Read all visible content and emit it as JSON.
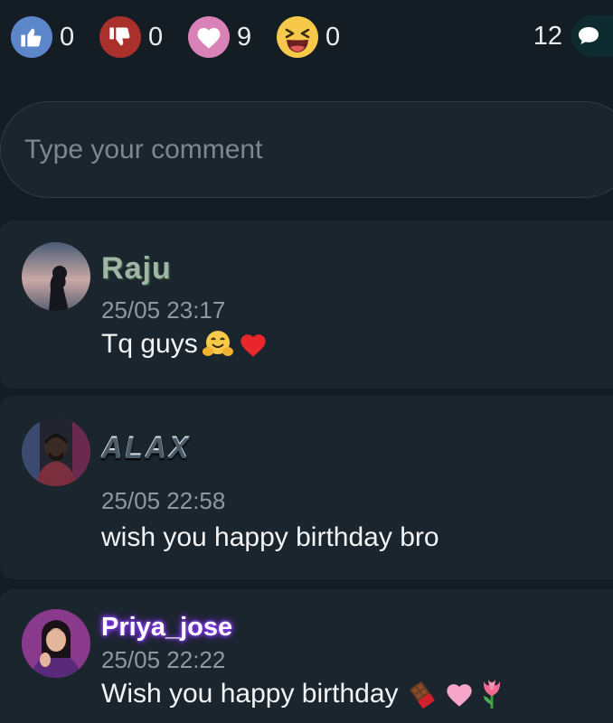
{
  "reactions": {
    "like_count": "0",
    "dislike_count": "0",
    "love_count": "9",
    "laugh_count": "0",
    "comment_count": "12",
    "colors": {
      "like": "#5b86c9",
      "dislike": "#a9302b",
      "love": "#d982b7",
      "laugh": "#f6c94a"
    }
  },
  "comment_input": {
    "placeholder": "Type your comment"
  },
  "comments": [
    {
      "username": "Raju",
      "timestamp": "25/05 23:17",
      "text": "Tq guys",
      "emojis": [
        "hugging-face-emoji",
        "red-heart-emoji"
      ]
    },
    {
      "username": "ALAX",
      "timestamp": "25/05 22:58",
      "text": "wish you happy birthday bro",
      "emojis": []
    },
    {
      "username": "Priya_jose",
      "timestamp": "25/05 22:22",
      "text": "Wish you happy birthday ",
      "emojis": [
        "chocolate-bar-emoji",
        "pink-heart-emoji",
        "tulip-emoji"
      ]
    }
  ]
}
